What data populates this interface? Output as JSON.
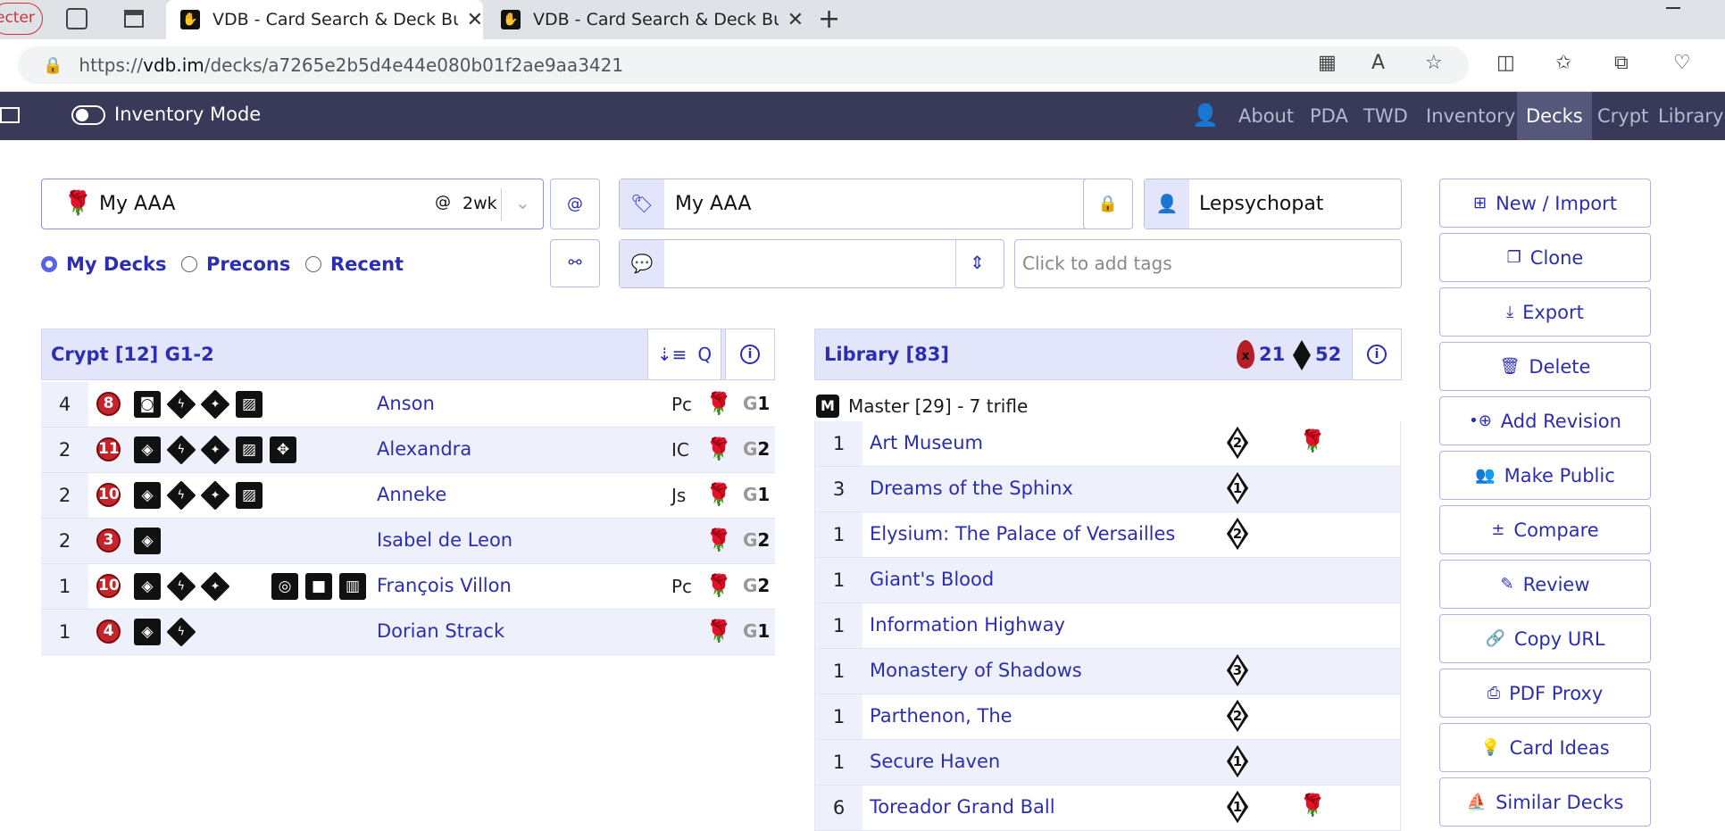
{
  "browser": {
    "tab_left_partial": "ecter",
    "tabs": [
      {
        "title": "VDB - Card Search & Deck Building"
      },
      {
        "title": "VDB - Card Search & Deck Building"
      }
    ],
    "url_prefix": "https://",
    "url_host": "vdb.im",
    "url_path": "/decks/a7265e2b5d4e44e080b01f2ae9aa3421"
  },
  "appnav": {
    "mode_label": "Inventory Mode",
    "links": [
      "About",
      "PDA",
      "TWD",
      "Inventory",
      "Decks",
      "Crypt",
      "Library"
    ],
    "selected": "Decks"
  },
  "deck_select": {
    "value": "My AAA",
    "at": "@",
    "age": "2wk",
    "radios": [
      {
        "label": "My Decks",
        "checked": true
      },
      {
        "label": "Precons",
        "checked": false
      },
      {
        "label": "Recent",
        "checked": false
      }
    ]
  },
  "deck_fields": {
    "name": "My AAA",
    "author": "Lepsychopat",
    "description": "",
    "tags_placeholder": "Click to add tags"
  },
  "actions": [
    "New / Import",
    "Clone",
    "Export",
    "Delete",
    "Add Revision",
    "Make Public",
    "Compare",
    "Review",
    "Copy URL",
    "PDF Proxy",
    "Card Ideas",
    "Similar Decks"
  ],
  "crypt": {
    "title": "Crypt [12] G1-2",
    "sort_label": "Q",
    "rows": [
      {
        "qty": "4",
        "cap": "8",
        "name": "Anson",
        "title": "Pc",
        "gen_g": "G",
        "gen_n": "1"
      },
      {
        "qty": "2",
        "cap": "11",
        "name": "Alexandra",
        "title": "IC",
        "gen_g": "G",
        "gen_n": "2"
      },
      {
        "qty": "2",
        "cap": "10",
        "name": "Anneke",
        "title": "Js",
        "gen_g": "G",
        "gen_n": "1"
      },
      {
        "qty": "2",
        "cap": "3",
        "name": "Isabel de Leon",
        "title": "",
        "gen_g": "G",
        "gen_n": "2"
      },
      {
        "qty": "1",
        "cap": "10",
        "name": "François Villon",
        "title": "Pc",
        "gen_g": "G",
        "gen_n": "2"
      },
      {
        "qty": "1",
        "cap": "4",
        "name": "Dorian Strack",
        "title": "",
        "gen_g": "G",
        "gen_n": "1"
      }
    ]
  },
  "library": {
    "title": "Library [83]",
    "blood_count": "21",
    "pool_count": "52",
    "section": "Master [29] - 7 trifle",
    "section_icon": "M",
    "rows": [
      {
        "qty": "1",
        "name": "Art Museum",
        "cost": "2"
      },
      {
        "qty": "3",
        "name": "Dreams of the Sphinx",
        "cost": "1"
      },
      {
        "qty": "1",
        "name": "Elysium: The Palace of Versailles",
        "cost": "2"
      },
      {
        "qty": "1",
        "name": "Giant's Blood",
        "cost": ""
      },
      {
        "qty": "1",
        "name": "Information Highway",
        "cost": ""
      },
      {
        "qty": "1",
        "name": "Monastery of Shadows",
        "cost": "3"
      },
      {
        "qty": "1",
        "name": "Parthenon, The",
        "cost": "2"
      },
      {
        "qty": "1",
        "name": "Secure Haven",
        "cost": "1"
      },
      {
        "qty": "6",
        "name": "Toreador Grand Ball",
        "cost": "1"
      }
    ]
  }
}
